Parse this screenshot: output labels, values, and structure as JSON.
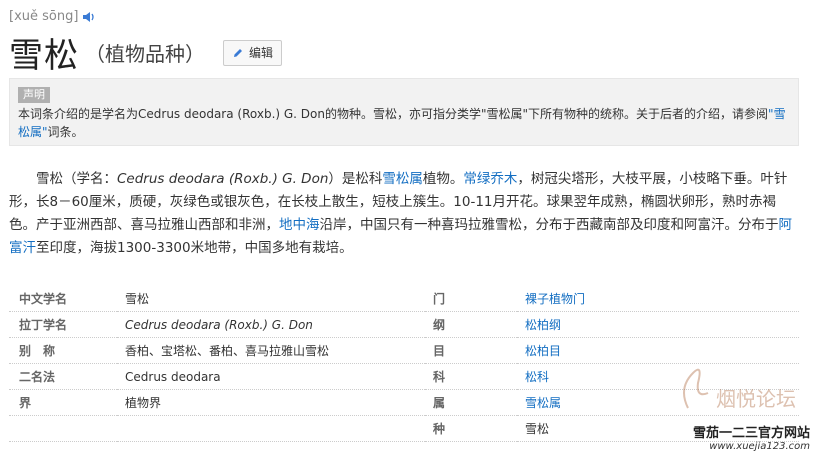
{
  "header": {
    "pinyin": "[xuě sōng]",
    "title": "雪松",
    "subtitle": "（植物品种）",
    "edit_label": "编辑"
  },
  "notice": {
    "tag": "声明",
    "text_before": "本词条介绍的是学名为Cedrus deodara (Roxb.) G. Don的物种。雪松，亦可指分类学\"雪松属\"下所有物种的统称。关于后者的介绍，请参阅",
    "link": "\"雪松属\"",
    "text_after": "词条。"
  },
  "summary": {
    "p1": "雪松（学名：",
    "latin": "Cedrus deodara (Roxb.) G. Don",
    "p2": "）是松科",
    "link1": "雪松属",
    "p3": "植物。",
    "link2": "常绿乔木",
    "p4": "，树冠尖塔形，大枝平展，小枝略下垂。叶针形，长8－60厘米，质硬，灰绿色或银灰色，在长枝上散生，短枝上簇生。10-11月开花。球果翌年成熟，椭圆状卵形，熟时赤褐色。产于亚洲西部、喜马拉雅山西部和非洲，",
    "link3": "地中海",
    "p5": "沿岸，中国只有一种喜玛拉雅雪松，分布于西藏南部及印度和阿富汗。分布于",
    "link4": "阿富汗",
    "p6": "至印度，海拔1300-3300米地带，中国多地有栽培。"
  },
  "infobox": {
    "rows": [
      {
        "k": "中文学名",
        "v": "雪松",
        "k2": "门",
        "v2": "裸子植物门"
      },
      {
        "k": "拉丁学名",
        "v": "Cedrus deodara (Roxb.) G. Don",
        "k2": "纲",
        "v2": "松柏纲"
      },
      {
        "k": "别　称",
        "v": "香柏、宝塔松、番柏、喜马拉雅山雪松",
        "k2": "目",
        "v2": "松柏目"
      },
      {
        "k": "二名法",
        "v": "Cedrus deodara",
        "k2": "科",
        "v2": "松科"
      },
      {
        "k": "界",
        "v": "植物界",
        "k2": "属",
        "v2": "雪松属"
      },
      {
        "k": "",
        "v": "",
        "k2": "种",
        "v2": "雪松"
      }
    ]
  },
  "watermark": {
    "logo_text": "烟悦论坛",
    "site_cn": "雪茄一二三官方网站",
    "site_url": "www.xuejia123.com"
  },
  "colors": {
    "link": "#136ec2",
    "notice_bg": "#f2f2f2",
    "tag_bg": "#b0b0b0"
  }
}
